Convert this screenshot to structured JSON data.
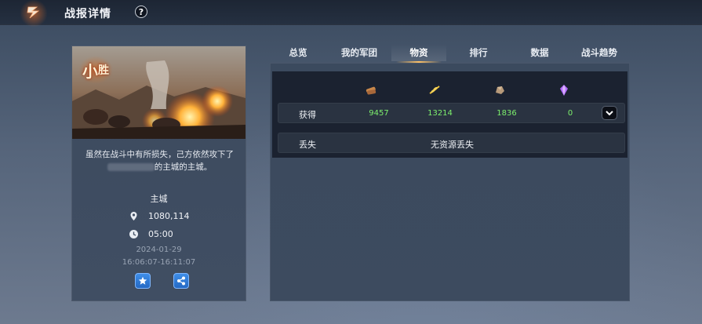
{
  "header": {
    "title": "战报详情",
    "help_label": "?"
  },
  "left_card": {
    "result_main": "小",
    "result_sub": "胜",
    "description_line1": "虽然在战斗中有所损失，己方依然攻下了",
    "description_line2_suffix": "的主城的主城。",
    "city_label": "主城",
    "coordinates": "1080,114",
    "duration": "05:00",
    "date": "2024-01-29",
    "time_range": "16:06:07-16:11:07"
  },
  "tabs": [
    {
      "label": "总览"
    },
    {
      "label": "我的军团"
    },
    {
      "label": "物资"
    },
    {
      "label": "排行"
    },
    {
      "label": "数据"
    },
    {
      "label": "战斗趋势"
    }
  ],
  "active_tab": "物资",
  "resources": {
    "icons": [
      "wood-icon",
      "wheat-icon",
      "stone-icon",
      "crystal-icon"
    ],
    "obtain": {
      "label": "获得",
      "values": [
        "9457",
        "13214",
        "1836",
        "0"
      ]
    },
    "lost": {
      "label": "丢失",
      "text": "无资源丢失"
    }
  },
  "colors": {
    "positive_value": "#7df06d",
    "accent": "#ffc266",
    "button_blue": "#2f7fdc"
  }
}
